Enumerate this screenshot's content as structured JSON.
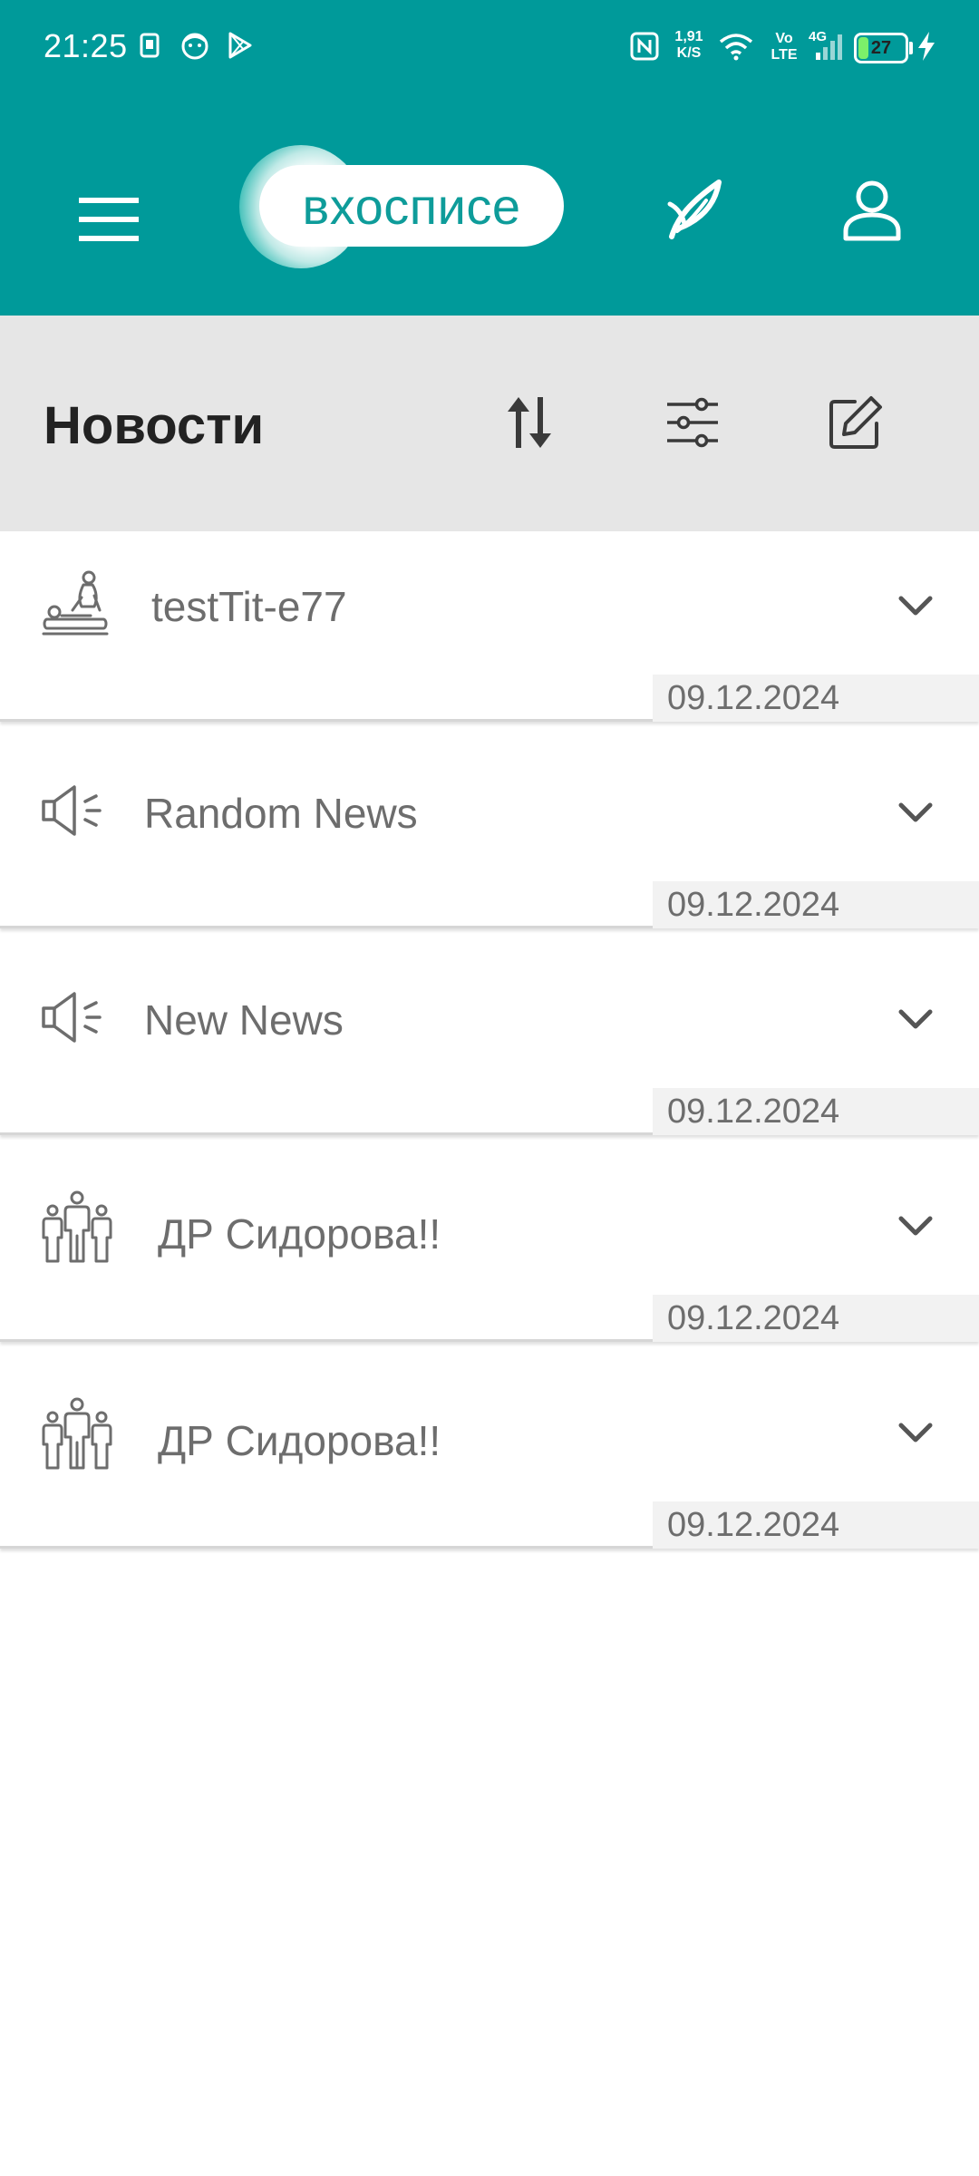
{
  "status_bar": {
    "time": "21:25",
    "net_speed_value": "1,91",
    "net_speed_unit": "K/S",
    "volte_top": "Vo",
    "volte_bottom": "LTE",
    "network_type": "4G",
    "battery_level": "27",
    "battery_fraction": 0.27,
    "icons": [
      "sim-icon",
      "face-notification-icon",
      "play-store-icon",
      "nfc-icon",
      "wifi-icon",
      "signal-icon",
      "charging-bolt-icon"
    ]
  },
  "app_bar": {
    "logo_text": "вхосписе",
    "menu_icon": "menu-icon",
    "quill_icon": "quill-icon",
    "profile_icon": "profile-icon"
  },
  "section": {
    "title": "Новости",
    "actions": [
      "sort-icon",
      "filter-icon",
      "edit-icon"
    ]
  },
  "news": [
    {
      "icon": "massage-icon",
      "title": "testTit-e77",
      "date": "09.12.2024"
    },
    {
      "icon": "megaphone-icon",
      "title": "Random News",
      "date": "09.12.2024"
    },
    {
      "icon": "megaphone-icon",
      "title": "New News",
      "date": "09.12.2024"
    },
    {
      "icon": "group-icon",
      "title": "ДР Сидорова!!",
      "date": "09.12.2024"
    },
    {
      "icon": "group-icon",
      "title": "ДР Сидорова!!",
      "date": "09.12.2024"
    }
  ],
  "colors": {
    "primary": "#009a9a",
    "section_bg": "#e6e6e6",
    "text_muted": "#6d6d6d",
    "date_bg": "#f2f2f2",
    "battery_fill": "#7cf06a"
  }
}
